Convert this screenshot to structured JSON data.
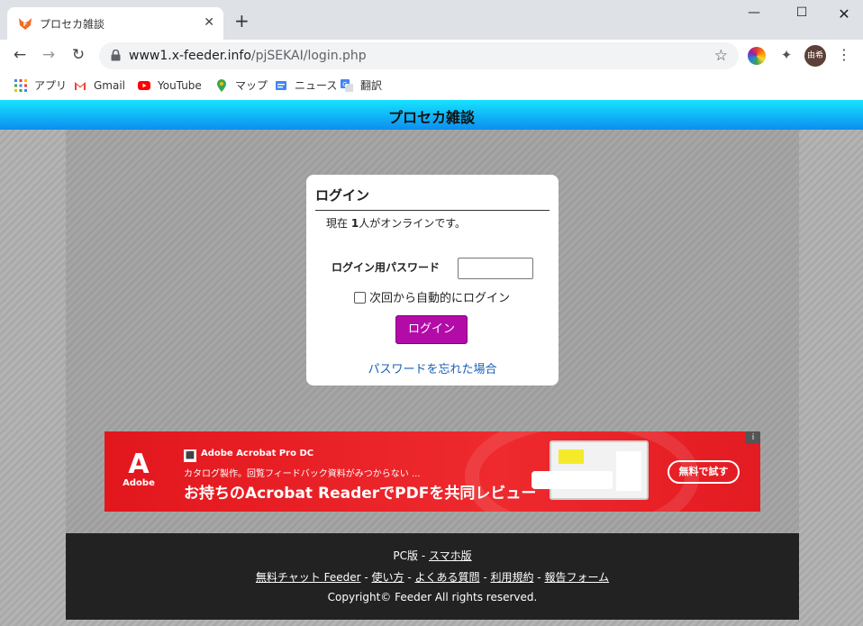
{
  "browser": {
    "tab_title": "プロセカ雑談",
    "url_host": "www1.x-feeder.info",
    "url_path": "/pjSEKAI/login.php",
    "avatar_text": "由希",
    "bookmarks": [
      "アプリ",
      "Gmail",
      "YouTube",
      "マップ",
      "ニュース",
      "翻訳"
    ]
  },
  "site": {
    "title": "プロセカ雑談",
    "header_gradient": [
      "#16e3ff",
      "#0b8ef0"
    ]
  },
  "login": {
    "heading": "ログイン",
    "online_prefix": "現在",
    "online_count": "1",
    "online_suffix": "人がオンラインです。",
    "password_label": "ログイン用パスワード",
    "password_value": "",
    "auto_login_label": "次回から自動的にログイン",
    "auto_login_checked": false,
    "button_label": "ログイン",
    "button_color": "#b30ba8",
    "forgot_link": "パスワードを忘れた場合"
  },
  "ad": {
    "brand": "Adobe",
    "product": "Adobe Acrobat Pro DC",
    "subline": "カタログ製作。回覧フィードバック資料がみつからない ...",
    "headline": "お持ちのAcrobat ReaderでPDFを共同レビュー",
    "cta": "無料で試す",
    "info_badge": "i",
    "color": "#e2171e"
  },
  "footer": {
    "pc_label": "PC版",
    "mobile_link": "スマホ版",
    "links": [
      "無料チャット Feeder",
      "使い方",
      "よくある質問",
      "利用規約",
      "報告フォーム"
    ],
    "copyright": "Copyright© Feeder All rights reserved."
  }
}
